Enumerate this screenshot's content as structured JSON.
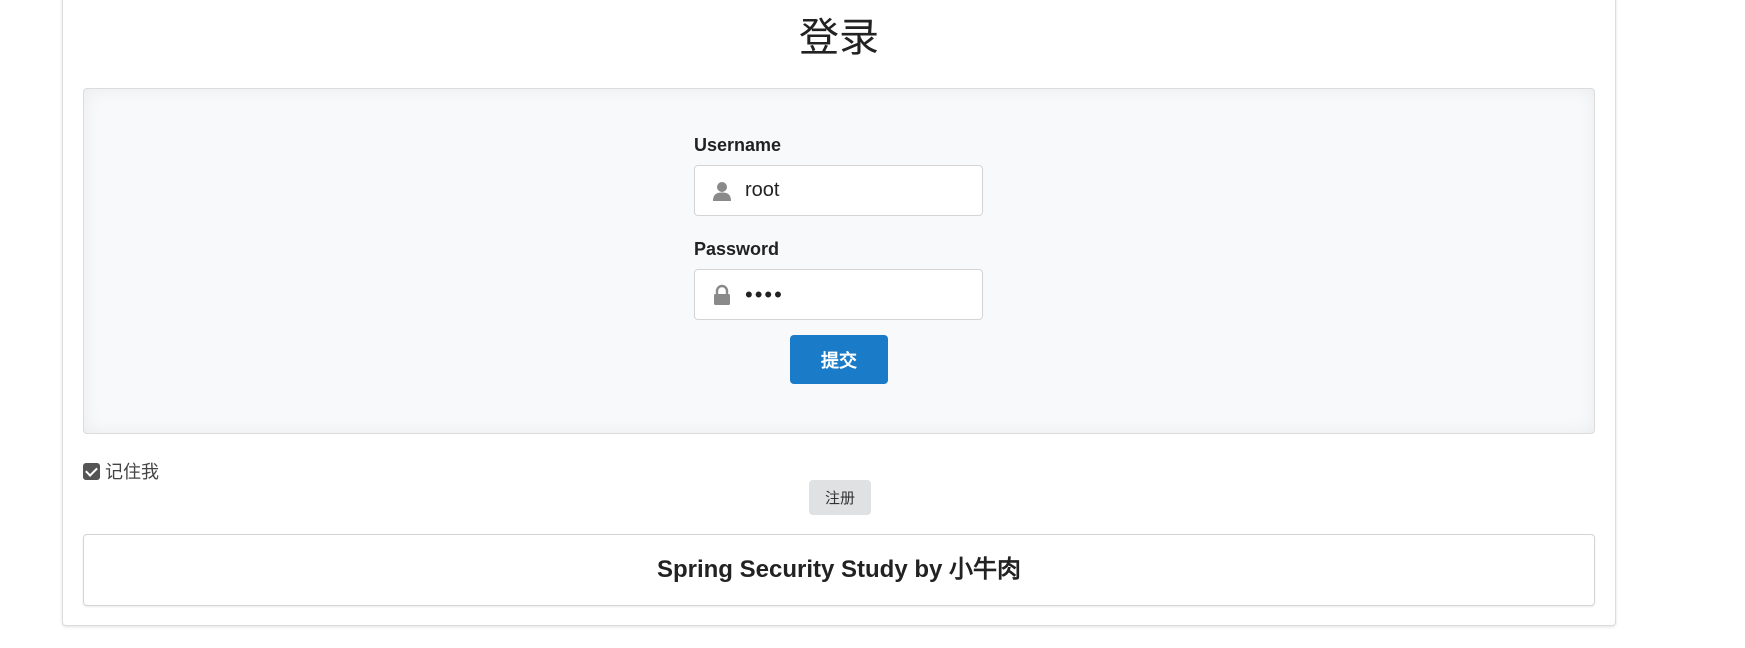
{
  "page": {
    "title": "登录"
  },
  "form": {
    "username_label": "Username",
    "username_value": "root",
    "username_icon": "user-icon",
    "password_label": "Password",
    "password_value": "••••",
    "password_icon": "lock-icon",
    "submit_label": "提交"
  },
  "remember": {
    "label": "记住我",
    "checked": true
  },
  "register": {
    "label": "注册"
  },
  "footer": {
    "text": "Spring Security Study by 小牛肉"
  },
  "colors": {
    "primary_button": "#1a7bc9",
    "secondary_button": "#e0e1e2",
    "panel_background": "#f8f9fa",
    "icon_gray": "#8a8a8a"
  }
}
